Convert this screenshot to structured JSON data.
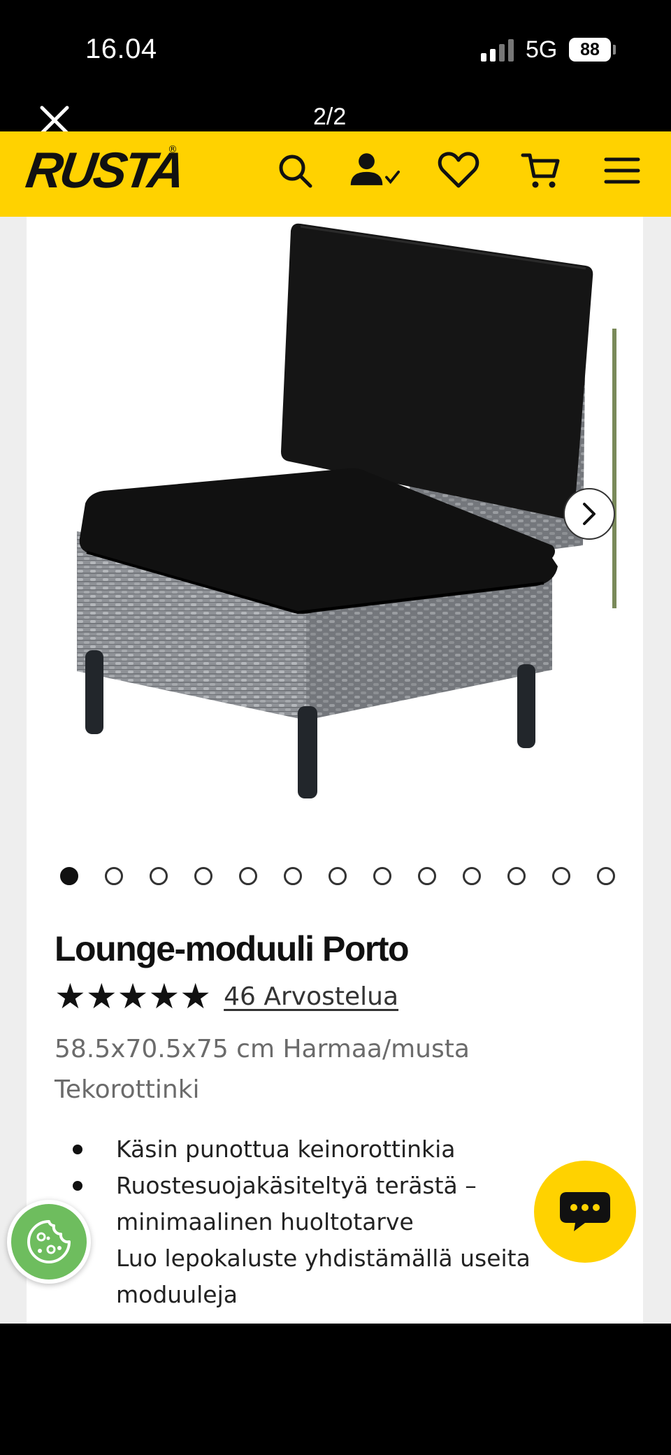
{
  "status_bar": {
    "time": "16.04",
    "network": "5G",
    "battery": "88"
  },
  "viewer": {
    "page_indicator": "2/2",
    "close_icon": "close-icon"
  },
  "header": {
    "logo": "RUSTA",
    "background_color": "#ffd200",
    "icons": [
      "search-icon",
      "account-icon",
      "heart-icon",
      "cart-icon",
      "menu-icon"
    ]
  },
  "gallery": {
    "image_alt": "armchair-image",
    "total_images": 13,
    "active_index": 0,
    "next_icon": "chevron-right-icon"
  },
  "product": {
    "title": "Lounge-moduuli Porto",
    "rating": 5,
    "stars": "★★★★★",
    "reviews": "46 Arvostelua",
    "subtitle": "58.5x70.5x75 cm Harmaa/musta Tekorottinki",
    "features": [
      "Käsin punottua keinorottinkia",
      "Ruostesuojakäsiteltyä terästä – minimaalinen huoltotarve",
      "Luo lepokaluste yhdistämällä useita moduuleja"
    ]
  },
  "floating": {
    "chat_icon": "chat-icon",
    "cookie_icon": "cookie-icon",
    "chat_color": "#ffd200",
    "cookie_color": "#6ebd5e"
  }
}
